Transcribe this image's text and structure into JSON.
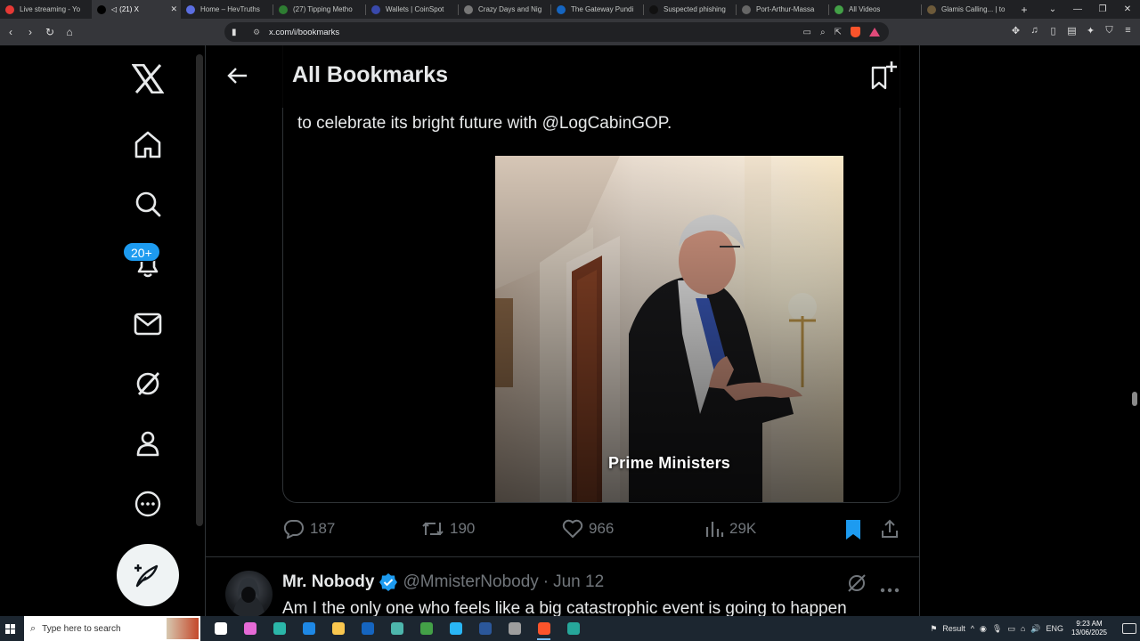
{
  "browser": {
    "tabs": [
      {
        "title": "Live streaming - Yo",
        "favicon_color": "#e53935",
        "active": false
      },
      {
        "title": "(21) X",
        "favicon_color": "#000000",
        "active": true,
        "muted": true
      },
      {
        "title": "Home – HevTruths",
        "favicon_color": "#5b6ee1",
        "active": false
      },
      {
        "title": "(27) Tipping Metho",
        "favicon_color": "#2e7d32",
        "active": false
      },
      {
        "title": "Wallets | CoinSpot",
        "favicon_color": "#3949ab",
        "active": false
      },
      {
        "title": "Crazy Days and Nig",
        "favicon_color": "#777777",
        "active": false
      },
      {
        "title": "The Gateway Pundi",
        "favicon_color": "#1565c0",
        "active": false
      },
      {
        "title": "Suspected phishing",
        "favicon_color": "#111111",
        "active": false
      },
      {
        "title": "Port-Arthur-Massa",
        "favicon_color": "#666666",
        "active": false
      },
      {
        "title": "All Videos",
        "favicon_color": "#43a047",
        "active": false
      },
      {
        "title": "Glamis Calling... | to",
        "favicon_color": "#6d5a3a",
        "active": false
      }
    ],
    "tab_close_glyph": "✕",
    "new_tab_glyph": "+",
    "url": "x.com/i/bookmarks",
    "colors": {
      "tabbar": "#202124",
      "toolbar": "#35363a",
      "brave": "#fb542b"
    }
  },
  "nav": {
    "icons": [
      "x-logo-icon",
      "home-icon",
      "search-icon",
      "notifications-icon",
      "messages-icon",
      "grok-icon",
      "profile-icon",
      "more-icon"
    ],
    "notifications_badge": "20+",
    "compose_icon": "compose-icon"
  },
  "header": {
    "title": "All Bookmarks",
    "back_icon": "back-arrow-icon",
    "add_icon": "add-bookmark-icon"
  },
  "tweet": {
    "text_tail": "to celebrate its bright future with @LogCabinGOP.",
    "video_caption": "Prime Ministers",
    "stats": {
      "replies": "187",
      "reposts": "190",
      "likes": "966",
      "views": "29K"
    },
    "bookmarked": true,
    "accent": "#1d9bf0"
  },
  "next_tweet": {
    "name": "Mr. Nobody",
    "verified": true,
    "handle": "@MmisterNobody",
    "separator": "·",
    "date": "Jun 12",
    "text": "Am I the only one who feels like a big catastrophic event is going to happen"
  },
  "taskbar": {
    "search_placeholder": "Type here to search",
    "apps": [
      {
        "name": "task-view",
        "color": "#ffffff",
        "active": false
      },
      {
        "name": "copilot",
        "color": "#e56ad6",
        "active": false
      },
      {
        "name": "edge",
        "color": "#2bb6a8",
        "active": false
      },
      {
        "name": "store",
        "color": "#1e88e5",
        "active": false
      },
      {
        "name": "file-explorer",
        "color": "#f9c74f",
        "active": false
      },
      {
        "name": "outlook",
        "color": "#1565c0",
        "active": false
      },
      {
        "name": "app-generic",
        "color": "#4db6ac",
        "active": false
      },
      {
        "name": "notes",
        "color": "#43a047",
        "active": false
      },
      {
        "name": "kodi",
        "color": "#29b6f6",
        "active": false
      },
      {
        "name": "word",
        "color": "#2b579a",
        "active": false
      },
      {
        "name": "app-dark",
        "color": "#9e9e9e",
        "active": false
      },
      {
        "name": "brave",
        "color": "#fb542b",
        "active": true
      },
      {
        "name": "app-green",
        "color": "#26a69a",
        "active": false
      }
    ],
    "tray_label": "Result",
    "language": "ENG",
    "time": "9:23 AM",
    "date": "13/06/2025"
  }
}
